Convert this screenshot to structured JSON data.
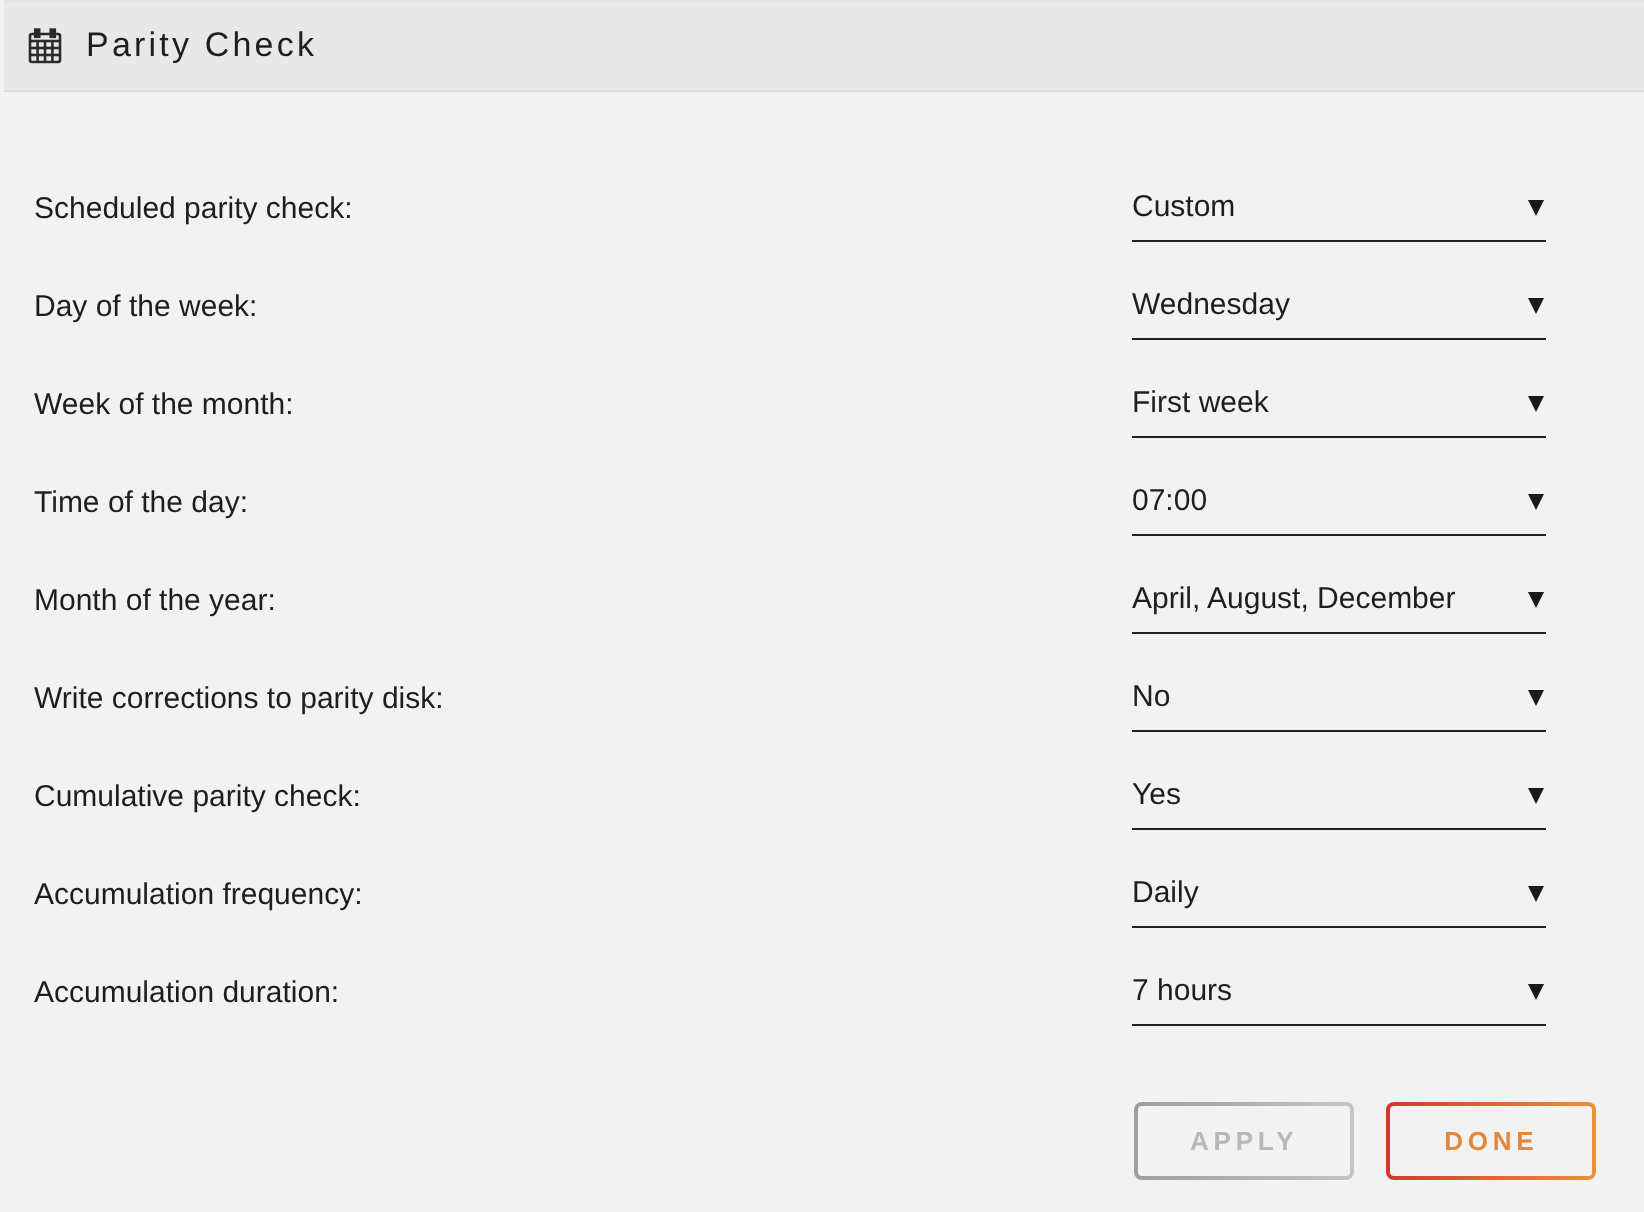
{
  "header": {
    "title": "Parity Check"
  },
  "fields": [
    {
      "label": "Scheduled parity check:",
      "value": "Custom"
    },
    {
      "label": "Day of the week:",
      "value": "Wednesday"
    },
    {
      "label": "Week of the month:",
      "value": "First week"
    },
    {
      "label": "Time of the day:",
      "value": "07:00"
    },
    {
      "label": "Month of the year:",
      "value": "April, August, December"
    },
    {
      "label": "Write corrections to parity disk:",
      "value": "No"
    },
    {
      "label": "Cumulative parity check:",
      "value": "Yes"
    },
    {
      "label": "Accumulation frequency:",
      "value": "Daily"
    },
    {
      "label": "Accumulation duration:",
      "value": "7 hours"
    }
  ],
  "buttons": [
    {
      "label": "APPLY",
      "disabled": true
    },
    {
      "label": "DONE",
      "disabled": false
    }
  ]
}
